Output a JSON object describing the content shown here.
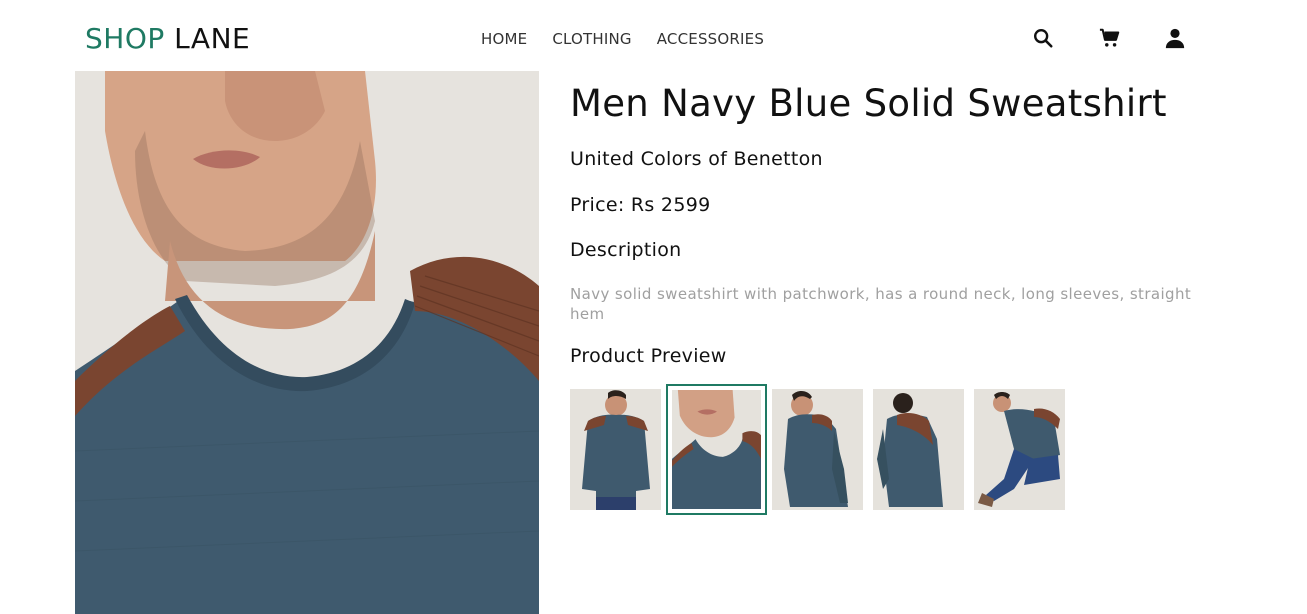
{
  "header": {
    "logo_part1": "SHOP",
    "logo_part2": "LANE",
    "nav": [
      {
        "label": "HOME"
      },
      {
        "label": "CLOTHING"
      },
      {
        "label": "ACCESSORIES"
      }
    ],
    "icons": [
      "search-icon",
      "cart-icon",
      "user-icon"
    ]
  },
  "product": {
    "title": "Men Navy Blue Solid Sweatshirt",
    "brand": "United Colors of Benetton",
    "price": "Price: Rs 2599",
    "description_heading": "Description",
    "description": "Navy solid sweatshirt with patchwork, has a round neck, long sleeves, straight hem",
    "preview_heading": "Product Preview",
    "selected_preview": 2,
    "preview_count": 5
  },
  "colors": {
    "accent": "#1f7a63",
    "sweater": "#3f5a6e",
    "patch": "#7a4530",
    "skin": "#d8a98a",
    "background": "#e6e3de"
  }
}
